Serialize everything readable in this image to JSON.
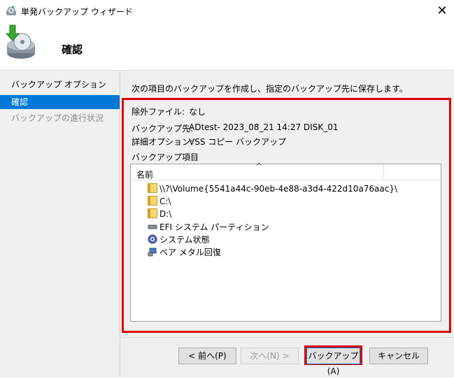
{
  "window": {
    "title": "単発バックアップ ウィザード",
    "close_glyph": "✕"
  },
  "header": {
    "title": "確認"
  },
  "sidebar": {
    "items": [
      {
        "label": "バックアップ オプション",
        "state": "normal"
      },
      {
        "label": "確認",
        "state": "active"
      },
      {
        "label": "バックアップの進行状況",
        "state": "disabled"
      }
    ]
  },
  "main": {
    "intro": "次の項目のバックアップを作成し、指定のバックアップ先に保存します。",
    "exclude_label": "除外ファイル:",
    "exclude_value": "なし",
    "dest_label": "バックアップ先:",
    "dest_value": "ADtest- 2023_08_21 14:27 DISK_01",
    "advanced_label": "詳細オプション:",
    "advanced_value": "VSS コピー バックアップ",
    "items_label": "バックアップ項目",
    "list": {
      "column_name": "名前",
      "sort_glyph": "^",
      "items": [
        {
          "label": "\\\\?\\Volume{5541a44c-90eb-4e88-a3d4-422d10a76aac}\\",
          "icon": "folder-icon"
        },
        {
          "label": "C:\\",
          "icon": "folder-icon"
        },
        {
          "label": "D:\\",
          "icon": "folder-icon"
        },
        {
          "label": "EFI システム パーティション",
          "icon": "drive-icon"
        },
        {
          "label": "システム状態",
          "icon": "gear-icon"
        },
        {
          "label": "ベア メタル回復",
          "icon": "computer-icon"
        }
      ]
    }
  },
  "buttons": {
    "back": "< 前へ(P)",
    "next": "次へ(N) >",
    "finish": "バックアップ(A)",
    "cancel": "キャンセル"
  },
  "colors": {
    "accent": "#0078d7",
    "highlight_red": "#e00000",
    "panel": "#f0f0f0"
  }
}
